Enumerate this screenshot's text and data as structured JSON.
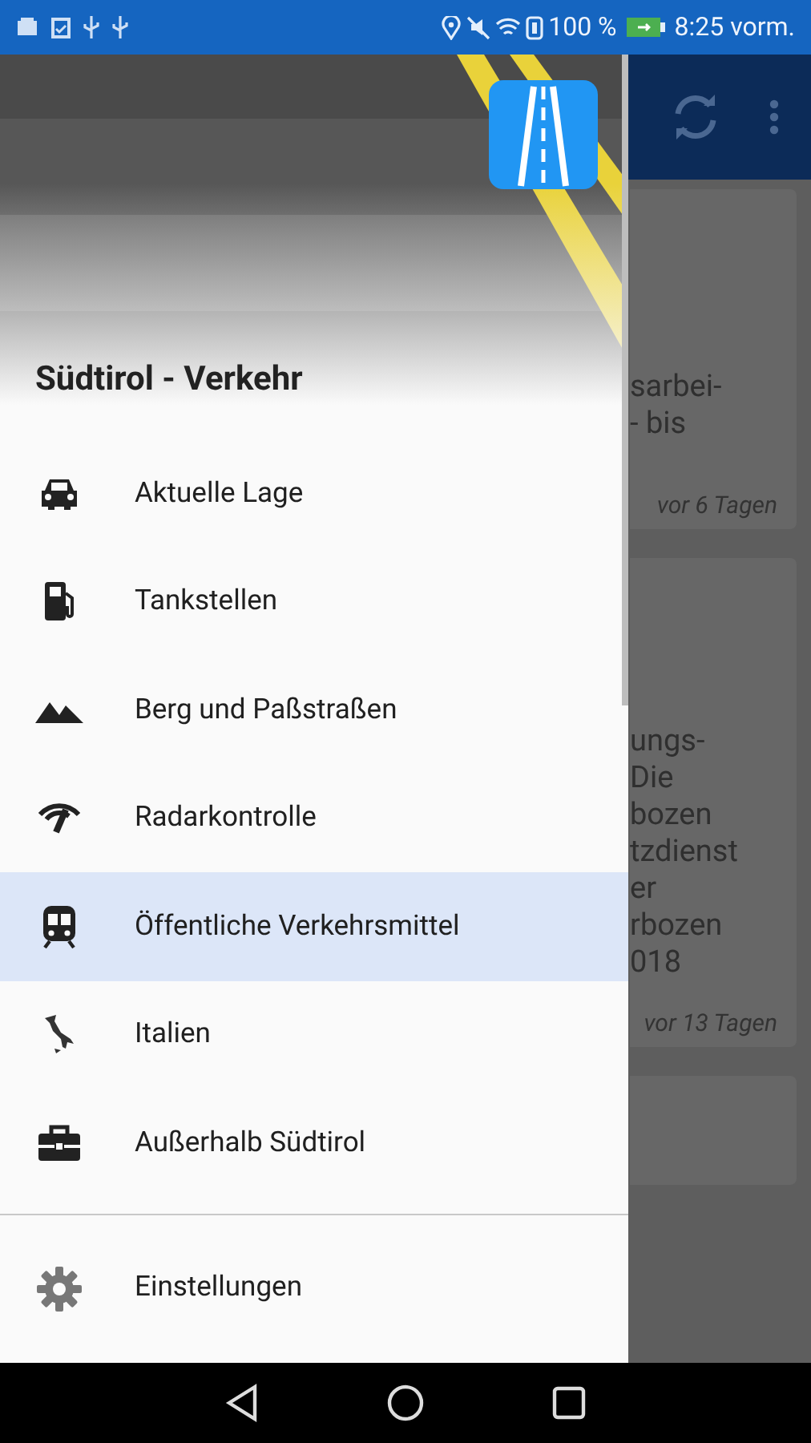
{
  "status_bar": {
    "battery": "100 %",
    "time": "8:25 vorm."
  },
  "background_cards": [
    {
      "kind": "card",
      "lines": [
        "sarbei-",
        "- bis"
      ],
      "age": "vor 6 Tagen"
    },
    {
      "kind": "card",
      "lines": [
        "ungs-",
        "Die",
        "bozen",
        "tzdienst",
        "er",
        "rbozen",
        "018"
      ],
      "age": "vor 13 Tagen"
    },
    {
      "kind": "card"
    }
  ],
  "drawer": {
    "title": "Südtirol - Verkehr",
    "items": [
      {
        "kind": "car",
        "label": "Aktuelle Lage",
        "selected": false
      },
      {
        "kind": "fuel",
        "label": "Tankstellen",
        "selected": false
      },
      {
        "kind": "mountain",
        "label": "Berg und Paßstraßen",
        "selected": false
      },
      {
        "kind": "radar",
        "label": "Radarkontrolle",
        "selected": false
      },
      {
        "kind": "train",
        "label": "Öffentliche Verkehrsmittel",
        "selected": true
      },
      {
        "kind": "italy",
        "label": "Italien",
        "selected": false
      },
      {
        "kind": "case",
        "label": "Außerhalb Südtirol",
        "selected": false
      }
    ],
    "footer_items": [
      {
        "kind": "gear",
        "label": "Einstellungen"
      }
    ]
  }
}
